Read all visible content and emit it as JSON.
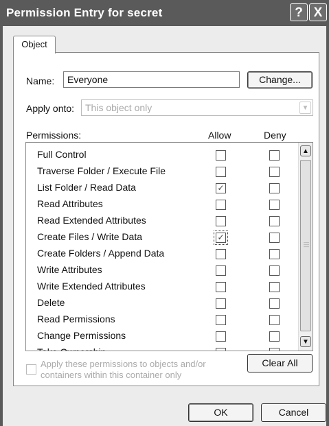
{
  "window": {
    "title": "Permission Entry for secret",
    "help_label": "?",
    "close_label": "X"
  },
  "tabs": [
    {
      "label": "Object",
      "selected": true
    }
  ],
  "name": {
    "label": "Name:",
    "value": "Everyone",
    "change_label": "Change..."
  },
  "apply_onto": {
    "label": "Apply onto:",
    "value": "This object only"
  },
  "permissions": {
    "label": "Permissions:",
    "allow_header": "Allow",
    "deny_header": "Deny",
    "items": [
      {
        "label": "Full Control",
        "allow": false,
        "deny": false
      },
      {
        "label": "Traverse Folder / Execute File",
        "allow": false,
        "deny": false
      },
      {
        "label": "List Folder / Read Data",
        "allow": true,
        "deny": false
      },
      {
        "label": "Read Attributes",
        "allow": false,
        "deny": false
      },
      {
        "label": "Read Extended Attributes",
        "allow": false,
        "deny": false
      },
      {
        "label": "Create Files / Write Data",
        "allow": true,
        "deny": false
      },
      {
        "label": "Create Folders / Append Data",
        "allow": false,
        "deny": false
      },
      {
        "label": "Write Attributes",
        "allow": false,
        "deny": false
      },
      {
        "label": "Write Extended Attributes",
        "allow": false,
        "deny": false
      },
      {
        "label": "Delete",
        "allow": false,
        "deny": false
      },
      {
        "label": "Read Permissions",
        "allow": false,
        "deny": false
      },
      {
        "label": "Change Permissions",
        "allow": false,
        "deny": false
      },
      {
        "label": "Take Ownership",
        "allow": false,
        "deny": false
      }
    ]
  },
  "apply_containers": {
    "text_line1": "Apply these permissions to objects and/or",
    "text_line2": "containers within this container only",
    "checked": false
  },
  "clear_all_label": "Clear All",
  "ok_label": "OK",
  "cancel_label": "Cancel"
}
